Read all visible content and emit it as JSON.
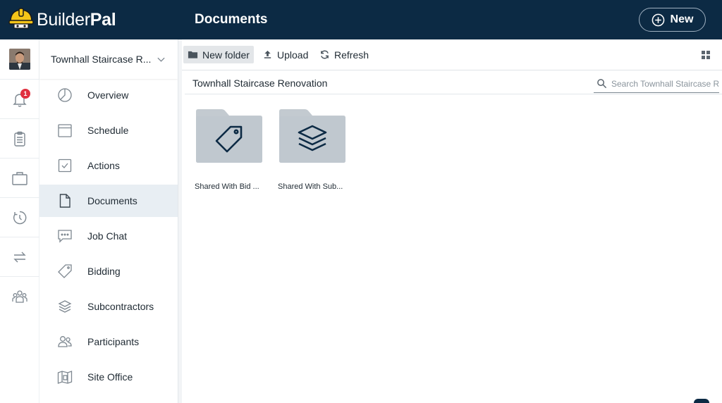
{
  "app": {
    "brand_regular": "Builder",
    "brand_bold": "Pal",
    "page_title": "Documents",
    "new_label": "New"
  },
  "rail": {
    "notification_count": "1"
  },
  "nav": {
    "project_name": "Townhall Staircase R...",
    "items": [
      {
        "label": "Overview",
        "icon": "pie-chart-icon"
      },
      {
        "label": "Schedule",
        "icon": "calendar-icon"
      },
      {
        "label": "Actions",
        "icon": "checkbox-icon"
      },
      {
        "label": "Documents",
        "icon": "document-icon"
      },
      {
        "label": "Job Chat",
        "icon": "chat-icon"
      },
      {
        "label": "Bidding",
        "icon": "tag-icon"
      },
      {
        "label": "Subcontractors",
        "icon": "layers-icon"
      },
      {
        "label": "Participants",
        "icon": "people-icon"
      },
      {
        "label": "Site Office",
        "icon": "site-office-icon"
      }
    ],
    "active_index": 3
  },
  "toolbar": {
    "new_folder_label": "New folder",
    "upload_label": "Upload",
    "refresh_label": "Refresh"
  },
  "path": {
    "title": "Townhall Staircase Renovation",
    "search_placeholder": "Search Townhall Staircase Renovation"
  },
  "folders": [
    {
      "label": "Shared With Bid ...",
      "icon": "tag-icon"
    },
    {
      "label": "Shared With Sub...",
      "icon": "layers-icon"
    }
  ],
  "colors": {
    "header_bg": "#0c2a44",
    "active_nav_bg": "#e8eef3",
    "folder_fill": "#c3cad0",
    "folder_icon": "#0c2a44",
    "badge": "#e0303f"
  }
}
